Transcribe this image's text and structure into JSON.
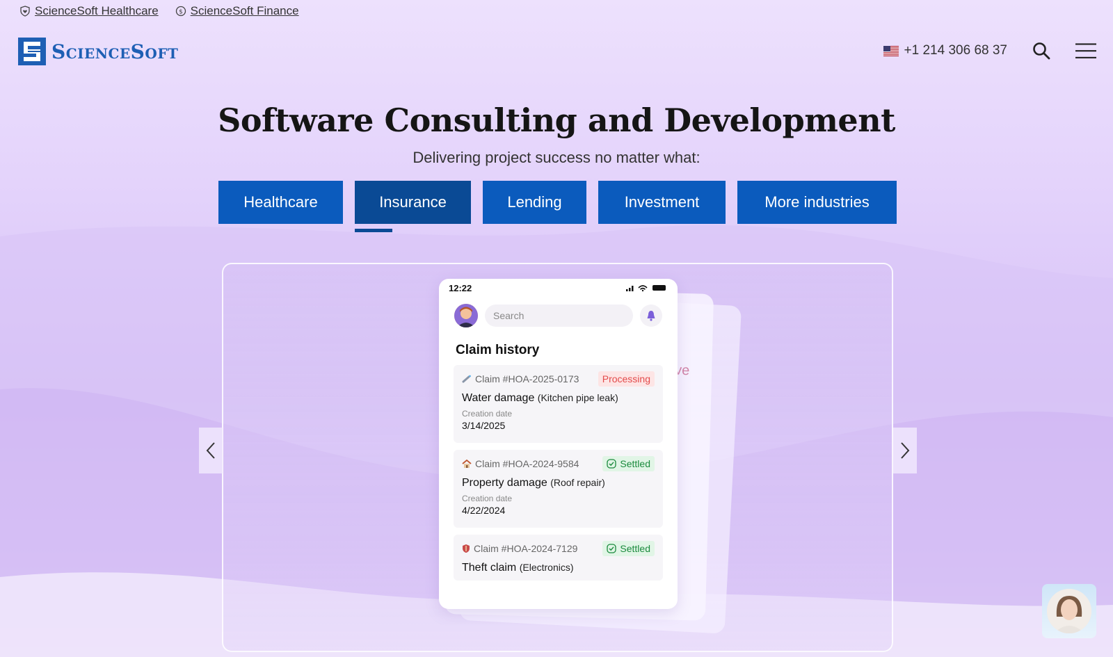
{
  "top_links": [
    {
      "label": "ScienceSoft Healthcare",
      "icon": "heart-shield-icon"
    },
    {
      "label": "ScienceSoft Finance",
      "icon": "dollar-coin-icon"
    }
  ],
  "header": {
    "logo_text": "ScienceSoft",
    "phone": "+1 214 306 68 37",
    "flag_icon": "us-flag-icon",
    "search_icon": "search-icon",
    "menu_icon": "hamburger-menu-icon"
  },
  "hero": {
    "title": "Software Consulting and Development",
    "subtitle": "Delivering project success no matter what:"
  },
  "tabs": [
    {
      "label": "Healthcare",
      "active": false
    },
    {
      "label": "Insurance",
      "active": true
    },
    {
      "label": "Lending",
      "active": false
    },
    {
      "label": "Investment",
      "active": false
    },
    {
      "label": "More industries",
      "active": false
    }
  ],
  "colors": {
    "tab_blue": "#0b5bbd",
    "tab_active": "#0a4a95",
    "logo_blue": "#1e5fb4",
    "processing_red": "#e34b4b",
    "settled_green": "#1b8a3d"
  },
  "phone_mock": {
    "time": "12:22",
    "search_placeholder": "Search",
    "section_title": "Claim history",
    "ghost_text": "ve",
    "claims": [
      {
        "id": "Claim #HOA-2025-0173",
        "icon": "pipe-icon",
        "status": "Processing",
        "type": "Water damage",
        "detail": "(Kitchen pipe leak)",
        "date_label": "Creation date",
        "date": "3/14/2025"
      },
      {
        "id": "Claim #HOA-2024-9584",
        "icon": "house-icon",
        "status": "Settled",
        "type": "Property damage",
        "detail": "(Roof repair)",
        "date_label": "Creation date",
        "date": "4/22/2024"
      },
      {
        "id": "Claim #HOA-2024-7129",
        "icon": "shield-icon",
        "status": "Settled",
        "type": "Theft claim",
        "detail": "(Electronics)"
      }
    ]
  }
}
